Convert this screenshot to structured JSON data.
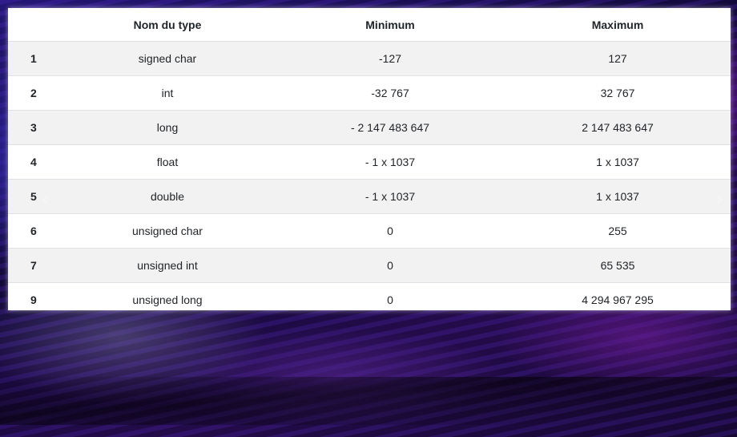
{
  "table": {
    "headers": [
      "",
      "Nom du type",
      "Minimum",
      "Maximum"
    ],
    "rows": [
      {
        "idx": "1",
        "type": "signed char",
        "min": "-127",
        "max": "127"
      },
      {
        "idx": "2",
        "type": "int",
        "min": "-32 767",
        "max": "32 767"
      },
      {
        "idx": "3",
        "type": "long",
        "min": "- 2 147 483 647",
        "max": "2 147 483 647"
      },
      {
        "idx": "4",
        "type": "float",
        "min": "- 1 x 1037",
        "max": "1 x 1037"
      },
      {
        "idx": "5",
        "type": "double",
        "min": "- 1 x 1037",
        "max": "1 x 1037"
      },
      {
        "idx": "6",
        "type": "unsigned char",
        "min": "0",
        "max": "255"
      },
      {
        "idx": "7",
        "type": "unsigned int",
        "min": "0",
        "max": "65 535"
      },
      {
        "idx": "9",
        "type": "unsigned long",
        "min": "0",
        "max": "4 294 967 295"
      }
    ]
  },
  "carousel": {
    "prev_icon": "‹",
    "next_icon": "›"
  },
  "colors": {
    "stripe": "#f2f2f2",
    "border": "#dee2e6",
    "text": "#212529"
  }
}
